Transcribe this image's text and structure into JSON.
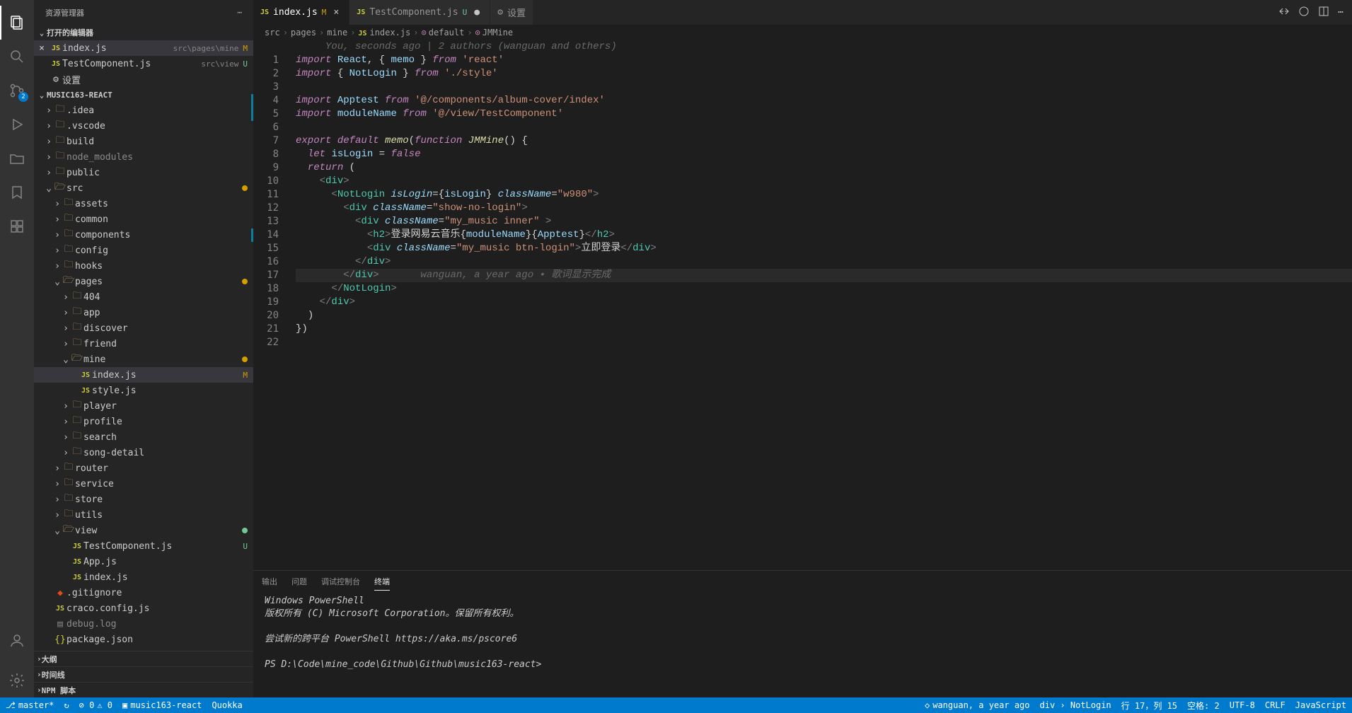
{
  "sidebar": {
    "title": "资源管理器",
    "openEditorsHeader": "打开的编辑器",
    "projectHeader": "MUSIC163-REACT",
    "collapsed": [
      "大纲",
      "时间线",
      "NPM 脚本"
    ]
  },
  "openEditors": [
    {
      "icon": "js",
      "name": "index.js",
      "path": "src\\pages\\mine",
      "status": "M",
      "active": true
    },
    {
      "icon": "js",
      "name": "TestComponent.js",
      "path": "src\\view",
      "status": "U"
    },
    {
      "icon": "gear",
      "name": "设置",
      "path": "",
      "status": ""
    }
  ],
  "tree": [
    {
      "depth": 0,
      "icon": "folder",
      "name": ".idea",
      "chev": ">"
    },
    {
      "depth": 0,
      "icon": "folder",
      "name": ".vscode",
      "chev": ">"
    },
    {
      "depth": 0,
      "icon": "folder",
      "name": "build",
      "chev": ">"
    },
    {
      "depth": 0,
      "icon": "folder",
      "name": "node_modules",
      "chev": ">",
      "dim": true
    },
    {
      "depth": 0,
      "icon": "folder",
      "name": "public",
      "chev": ">"
    },
    {
      "depth": 0,
      "icon": "folder-open",
      "name": "src",
      "chev": "v",
      "dot": "m"
    },
    {
      "depth": 1,
      "icon": "folder",
      "name": "assets",
      "chev": ">"
    },
    {
      "depth": 1,
      "icon": "folder",
      "name": "common",
      "chev": ">"
    },
    {
      "depth": 1,
      "icon": "folder",
      "name": "components",
      "chev": ">"
    },
    {
      "depth": 1,
      "icon": "folder",
      "name": "config",
      "chev": ">"
    },
    {
      "depth": 1,
      "icon": "folder",
      "name": "hooks",
      "chev": ">"
    },
    {
      "depth": 1,
      "icon": "folder-open",
      "name": "pages",
      "chev": "v",
      "dot": "m"
    },
    {
      "depth": 2,
      "icon": "folder",
      "name": "404",
      "chev": ">"
    },
    {
      "depth": 2,
      "icon": "folder",
      "name": "app",
      "chev": ">"
    },
    {
      "depth": 2,
      "icon": "folder",
      "name": "discover",
      "chev": ">"
    },
    {
      "depth": 2,
      "icon": "folder",
      "name": "friend",
      "chev": ">"
    },
    {
      "depth": 2,
      "icon": "folder-open",
      "name": "mine",
      "chev": "v",
      "dot": "m"
    },
    {
      "depth": 3,
      "icon": "js",
      "name": "index.js",
      "stat": "M",
      "active": true
    },
    {
      "depth": 3,
      "icon": "js",
      "name": "style.js"
    },
    {
      "depth": 2,
      "icon": "folder",
      "name": "player",
      "chev": ">"
    },
    {
      "depth": 2,
      "icon": "folder",
      "name": "profile",
      "chev": ">"
    },
    {
      "depth": 2,
      "icon": "folder",
      "name": "search",
      "chev": ">"
    },
    {
      "depth": 2,
      "icon": "folder",
      "name": "song-detail",
      "chev": ">"
    },
    {
      "depth": 1,
      "icon": "folder",
      "name": "router",
      "chev": ">"
    },
    {
      "depth": 1,
      "icon": "folder",
      "name": "service",
      "chev": ">"
    },
    {
      "depth": 1,
      "icon": "folder",
      "name": "store",
      "chev": ">"
    },
    {
      "depth": 1,
      "icon": "folder",
      "name": "utils",
      "chev": ">"
    },
    {
      "depth": 1,
      "icon": "folder-open",
      "name": "view",
      "chev": "v",
      "dot": "u"
    },
    {
      "depth": 2,
      "icon": "js",
      "name": "TestComponent.js",
      "stat": "U"
    },
    {
      "depth": 2,
      "icon": "js",
      "name": "App.js"
    },
    {
      "depth": 2,
      "icon": "js",
      "name": "index.js"
    },
    {
      "depth": 0,
      "icon": "git",
      "name": ".gitignore"
    },
    {
      "depth": 0,
      "icon": "js",
      "name": "craco.config.js"
    },
    {
      "depth": 0,
      "icon": "log",
      "name": "debug.log",
      "dim": true
    },
    {
      "depth": 0,
      "icon": "json",
      "name": "package.json"
    }
  ],
  "tabs": [
    {
      "icon": "js",
      "name": "index.js",
      "stat": "M",
      "active": true,
      "close": "×"
    },
    {
      "icon": "js",
      "name": "TestComponent.js",
      "stat": "U",
      "close": "●"
    },
    {
      "icon": "gear",
      "name": "设置",
      "stat": "",
      "close": ""
    }
  ],
  "breadcrumb": [
    "src",
    "pages",
    "mine",
    "index.js",
    "default",
    "JMMine"
  ],
  "codeAnnotation": "You, seconds ago | 2 authors (wanguan and others)",
  "inlineBlame": "wanguan, a year ago • 歌词显示完成",
  "code": {
    "lines": 22
  },
  "terminal": {
    "tabs": [
      "输出",
      "问题",
      "调试控制台",
      "终端"
    ],
    "activeTab": 3,
    "lines": [
      "Windows PowerShell",
      "版权所有 (C) Microsoft Corporation。保留所有权利。",
      "",
      "尝试新的跨平台 PowerShell https://aka.ms/pscore6",
      "",
      "PS D:\\Code\\mine_code\\Github\\Github\\music163-react>"
    ]
  },
  "statusBar": {
    "branch": "master*",
    "sync": "↻",
    "errors": "⊘ 0",
    "warnings": "⚠ 0",
    "project": "music163-react",
    "quokka": "Quokka",
    "blame": "wanguan, a year ago",
    "breadcrumb": "div › NotLogin",
    "lncol": "行 17，列 15",
    "spaces": "空格: 2",
    "encoding": "UTF-8",
    "eol": "CRLF",
    "lang": "JavaScript"
  },
  "scmBadge": "2"
}
